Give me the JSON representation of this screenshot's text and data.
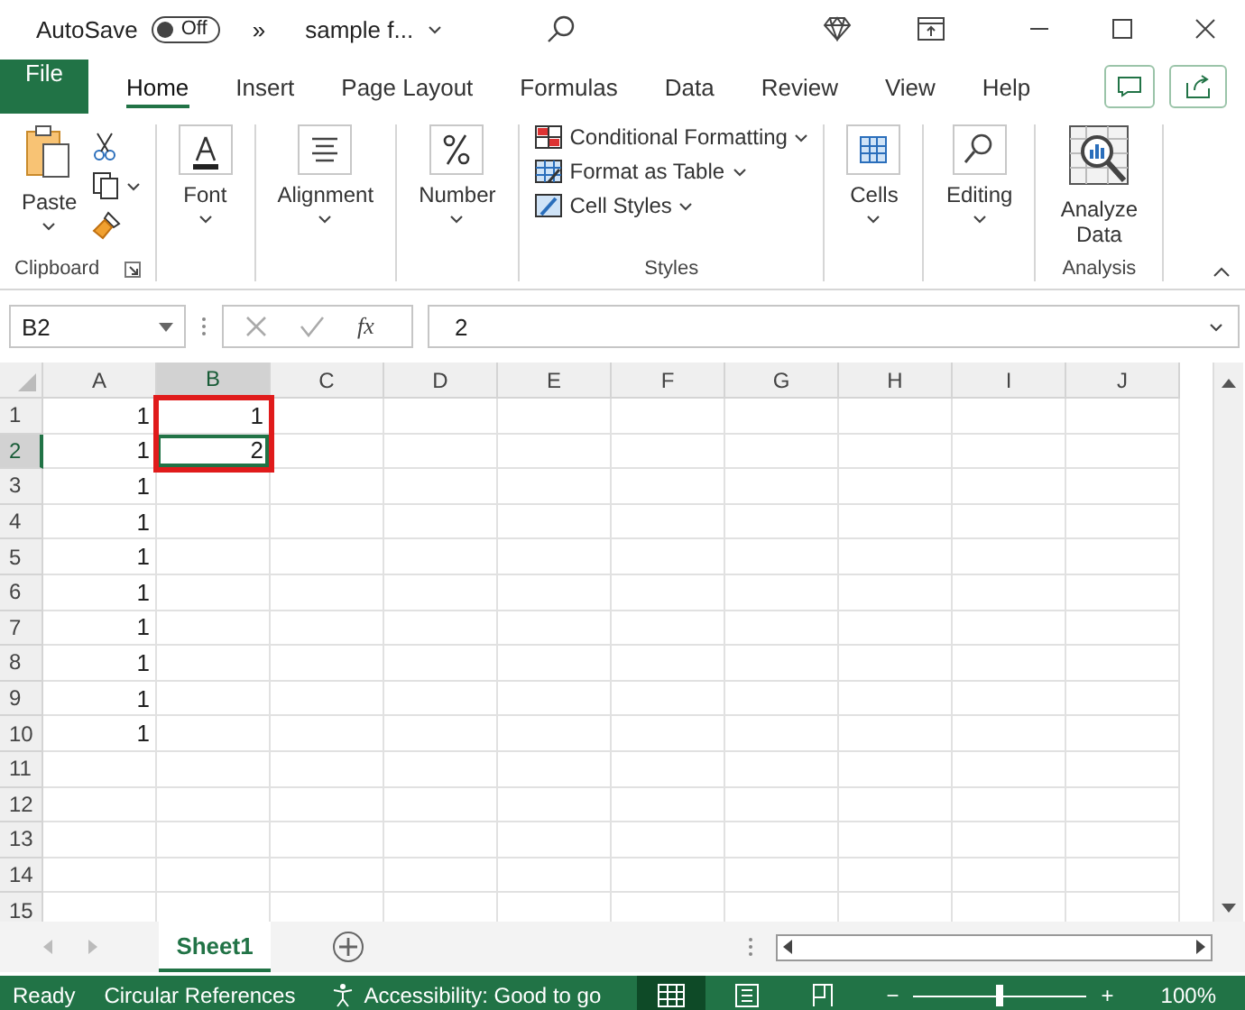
{
  "title_bar": {
    "autosave_label": "AutoSave",
    "autosave": {
      "label": "Off",
      "on": false
    },
    "overflow": "»",
    "file_name": "sample f..."
  },
  "tabs": [
    {
      "label": "File",
      "kind": "file",
      "selected": false
    },
    {
      "label": "Home",
      "kind": "tab",
      "selected": true
    },
    {
      "label": "Insert",
      "kind": "tab",
      "selected": false
    },
    {
      "label": "Page Layout",
      "kind": "tab",
      "selected": false
    },
    {
      "label": "Formulas",
      "kind": "tab",
      "selected": false
    },
    {
      "label": "Data",
      "kind": "tab",
      "selected": false
    },
    {
      "label": "Review",
      "kind": "tab",
      "selected": false
    },
    {
      "label": "View",
      "kind": "tab",
      "selected": false
    },
    {
      "label": "Help",
      "kind": "tab",
      "selected": false
    }
  ],
  "ribbon": {
    "groups": [
      {
        "kind": "clipboard",
        "name": "Clipboard",
        "buttons": [
          {
            "label": "Paste",
            "kind": "paste"
          }
        ]
      },
      {
        "kind": "plain",
        "buttons": [
          {
            "label": "Font",
            "kind": "font"
          }
        ]
      },
      {
        "kind": "plain",
        "buttons": [
          {
            "label": "Alignment",
            "kind": "alignment"
          }
        ]
      },
      {
        "kind": "plain",
        "buttons": [
          {
            "label": "Number",
            "kind": "number"
          }
        ]
      },
      {
        "kind": "styles",
        "name": "Styles",
        "buttons": [
          {
            "label": "Conditional Formatting",
            "kind": "conditional"
          },
          {
            "label": "Format as Table",
            "kind": "table"
          },
          {
            "label": "Cell Styles",
            "kind": "cellstyles"
          }
        ]
      },
      {
        "kind": "plain",
        "buttons": [
          {
            "label": "Cells",
            "kind": "cells"
          }
        ]
      },
      {
        "kind": "plain",
        "buttons": [
          {
            "label": "Editing",
            "kind": "editing"
          }
        ]
      },
      {
        "kind": "analysis",
        "name": "Analysis",
        "buttons": [
          {
            "label": "Analyze Data",
            "kind": "analyze"
          }
        ]
      }
    ]
  },
  "formula_bar": {
    "name_box": "B2",
    "fx": "fx",
    "formula": "2"
  },
  "grid": {
    "columns": [
      {
        "label": "A",
        "selected": false
      },
      {
        "label": "B",
        "selected": true
      },
      {
        "label": "C",
        "selected": false
      },
      {
        "label": "D",
        "selected": false
      },
      {
        "label": "E",
        "selected": false
      },
      {
        "label": "F",
        "selected": false
      },
      {
        "label": "G",
        "selected": false
      },
      {
        "label": "H",
        "selected": false
      },
      {
        "label": "I",
        "selected": false
      },
      {
        "label": "J",
        "selected": false
      }
    ],
    "rows": [
      {
        "label": "1",
        "selected": false,
        "cells": [
          {
            "text": "1",
            "active": false,
            "marked": false
          },
          {
            "text": "1",
            "active": false,
            "marked": true
          }
        ]
      },
      {
        "label": "2",
        "selected": true,
        "cells": [
          {
            "text": "1",
            "active": false,
            "marked": false
          },
          {
            "text": "2",
            "active": true,
            "marked": true
          }
        ]
      },
      {
        "label": "3",
        "selected": false,
        "cells": [
          {
            "text": "1",
            "active": false,
            "marked": false
          }
        ]
      },
      {
        "label": "4",
        "selected": false,
        "cells": [
          {
            "text": "1",
            "active": false,
            "marked": false
          }
        ]
      },
      {
        "label": "5",
        "selected": false,
        "cells": [
          {
            "text": "1",
            "active": false,
            "marked": false
          }
        ]
      },
      {
        "label": "6",
        "selected": false,
        "cells": [
          {
            "text": "1",
            "active": false,
            "marked": false
          }
        ]
      },
      {
        "label": "7",
        "selected": false,
        "cells": [
          {
            "text": "1",
            "active": false,
            "marked": false
          }
        ]
      },
      {
        "label": "8",
        "selected": false,
        "cells": [
          {
            "text": "1",
            "active": false,
            "marked": false
          }
        ]
      },
      {
        "label": "9",
        "selected": false,
        "cells": [
          {
            "text": "1",
            "active": false,
            "marked": false
          }
        ]
      },
      {
        "label": "10",
        "selected": false,
        "cells": [
          {
            "text": "1",
            "active": false,
            "marked": false
          }
        ]
      },
      {
        "label": "11",
        "selected": false
      },
      {
        "label": "12",
        "selected": false
      },
      {
        "label": "13",
        "selected": false
      },
      {
        "label": "14",
        "selected": false
      },
      {
        "label": "15",
        "selected": false
      }
    ]
  },
  "sheets": [
    {
      "label": "Sheet1",
      "selected": true
    }
  ],
  "status_bar": {
    "ready": "Ready",
    "circular": "Circular References",
    "accessibility": "Accessibility: Good to go",
    "views": [
      {
        "kind": "normal",
        "selected": true
      },
      {
        "kind": "page_layout",
        "selected": false
      },
      {
        "kind": "page_break",
        "selected": false
      }
    ],
    "zoom_out": "−",
    "zoom_in": "+",
    "zoom": {
      "level": 0.5
    },
    "zoom_label": "100%"
  }
}
